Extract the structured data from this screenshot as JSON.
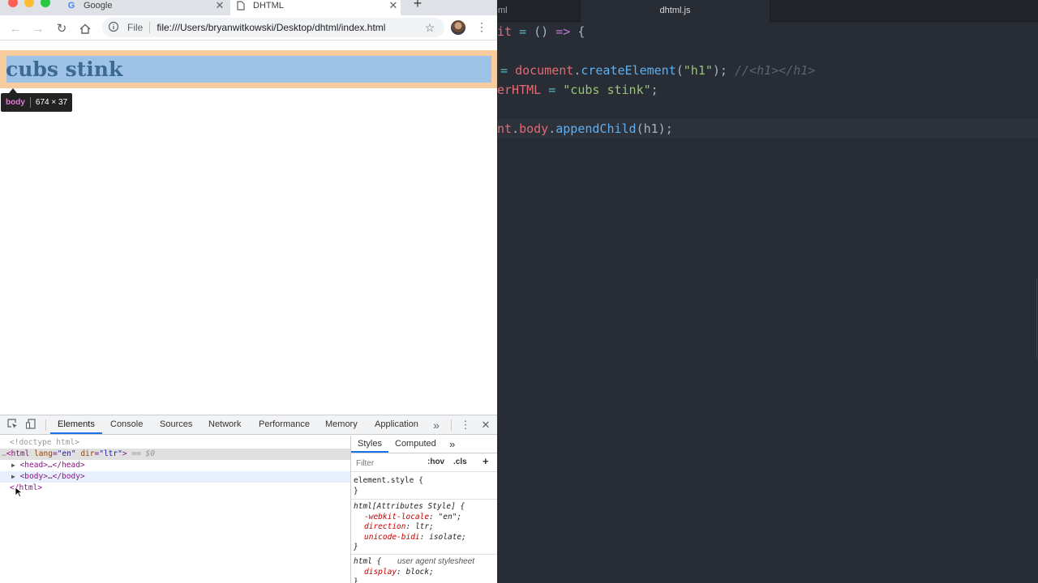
{
  "browser": {
    "tabs": [
      {
        "title": "Google",
        "favicon": "google-g-icon"
      },
      {
        "title": "DHTML",
        "favicon": "page-icon"
      }
    ],
    "address": {
      "scheme_label": "File",
      "url": "file:///Users/bryanwitkowski/Desktop/dhtml/index.html"
    },
    "page": {
      "heading": "cubs stink"
    },
    "inspect_tooltip": {
      "tag": "body",
      "size": "674 × 37"
    }
  },
  "devtools": {
    "tabs": [
      "Elements",
      "Console",
      "Sources",
      "Network",
      "Performance",
      "Memory",
      "Application"
    ],
    "active_tab": "Elements",
    "dom": {
      "doctype": "<!doctype html>",
      "html_open": {
        "tag": "<html",
        "attrs": [
          {
            "name": "lang",
            "value": "\"en\""
          },
          {
            "name": "dir",
            "value": "\"ltr\""
          }
        ],
        "suffix": "== $0"
      },
      "head": "<head>…</head>",
      "body": "<body>…</body>",
      "html_close": "</html>"
    },
    "styles": {
      "tabs": [
        "Styles",
        "Computed"
      ],
      "filter_placeholder": "Filter",
      "hov": ":hov",
      "cls": ".cls",
      "element_style": "element.style {",
      "close_brace": "}",
      "attr_rule": {
        "selector": "html[Attributes Style] {",
        "props": [
          {
            "name": "-webkit-locale",
            "value": "\"en\";"
          },
          {
            "name": "direction",
            "value": "ltr;"
          },
          {
            "name": "unicode-bidi",
            "value": "isolate;"
          }
        ]
      },
      "ua_rule": {
        "selector": "html {",
        "source": "user agent stylesheet",
        "prop": "display",
        "value": "block;"
      }
    }
  },
  "editor": {
    "tabs": [
      "ml",
      "dhtml.js"
    ],
    "active_tab": "dhtml.js"
  },
  "colors": {
    "margin_highlight": "#f6c48f",
    "content_highlight": "#9fc2e7",
    "editor_bg": "#282c34"
  }
}
